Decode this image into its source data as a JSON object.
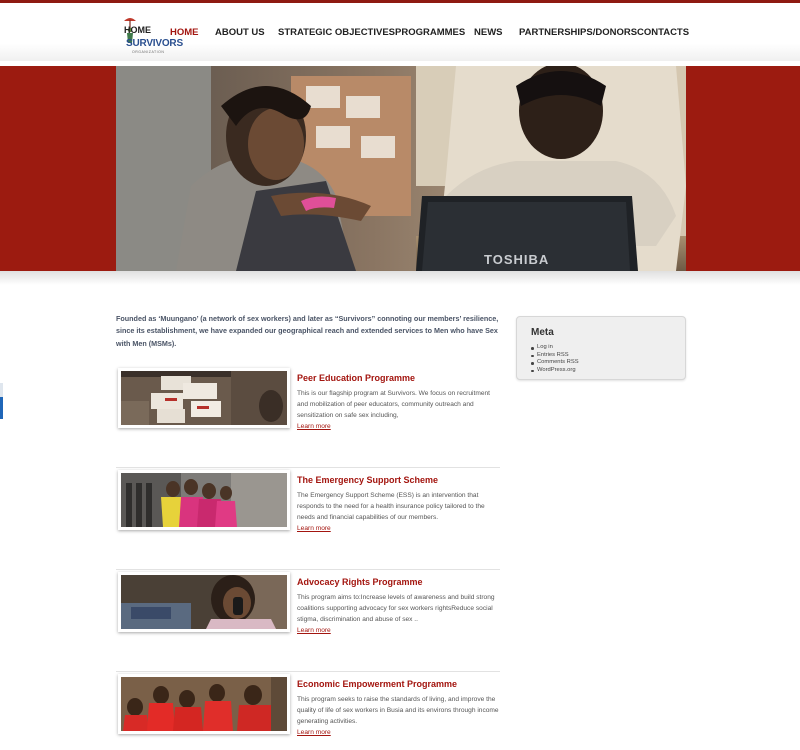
{
  "logo": {
    "home_text": "HOME",
    "name": "SURVIVORS",
    "subtitle": "ORGANIZATION"
  },
  "nav": {
    "items": [
      {
        "label": "HOME",
        "active": true
      },
      {
        "label": "ABOUT US",
        "active": false
      },
      {
        "label": "STRATEGIC OBJECTIVES",
        "active": false
      },
      {
        "label": "PROGRAMMES",
        "active": false
      },
      {
        "label": "NEWS",
        "active": false
      },
      {
        "label": "PARTNERSHIPS/DONORS",
        "active": false
      },
      {
        "label": "CONTACTS",
        "active": false
      }
    ]
  },
  "hero": {
    "laptop_brand": "TOSHIBA"
  },
  "intro": "Founded as ‘Muungano’ (a network of sex workers) and later as “Survivors” connoting our members’ resilience, since its establishment, we have expanded our geographical reach and extended services to Men who have Sex with Men (MSMs).",
  "programmes": [
    {
      "title": "Peer Education Programme",
      "description": "This is our flagship program at Survivors. We focus on recruitment and mobilization of peer educators, community outreach and sensitization on safe sex including,",
      "link": "Learn more"
    },
    {
      "title": "The Emergency Support Scheme",
      "description": "The Emergency Support Scheme (ESS) is an intervention that responds to the need for a health insurance policy tailored to the needs and financial capabilities of our members.",
      "link": "Learn more"
    },
    {
      "title": "Advocacy Rights Programme",
      "description": "This program aims to:Increase levels of awareness and build strong coalitions supporting advocacy for sex workers rightsReduce social stigma, discrimination and abuse of sex ..",
      "link": "Learn more"
    },
    {
      "title": "Economic Empowerment Programme",
      "description": "This program seeks to raise the standards of living, and improve the quality of life of sex workers in Busia and its environs through income generating activities.",
      "link": "Learn more"
    }
  ],
  "sidebar": {
    "title": "Meta",
    "links": [
      "Log in",
      "Entries RSS",
      "Comments RSS",
      "WordPress.org"
    ]
  },
  "colors": {
    "brand_red": "#a3150f",
    "banner_red": "#9c1b10",
    "nav_text": "#222222"
  }
}
